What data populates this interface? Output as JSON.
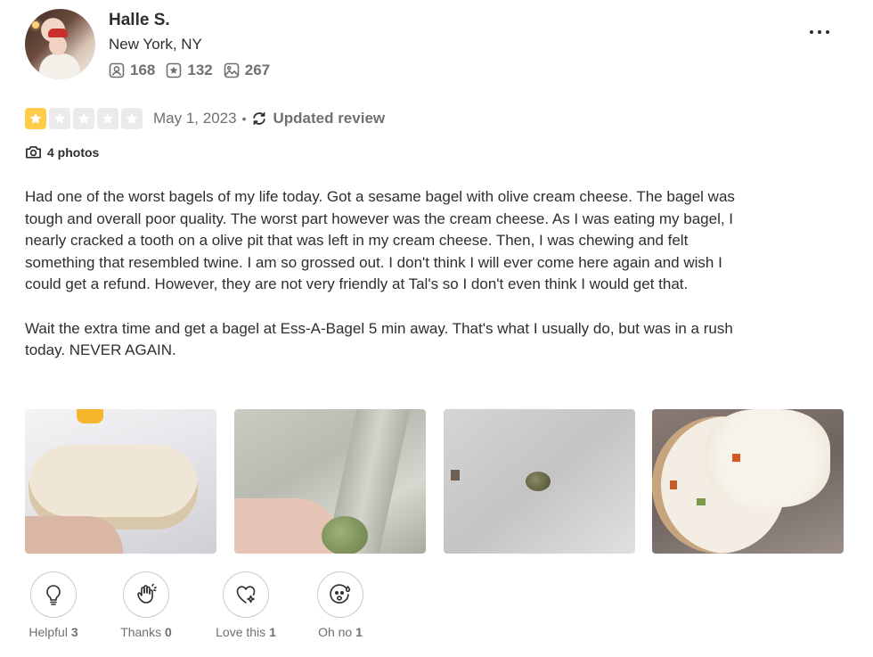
{
  "user": {
    "name": "Halle S.",
    "location": "New York, NY",
    "stats": {
      "friends": "168",
      "reviews": "132",
      "photos": "267"
    }
  },
  "review": {
    "rating": 1,
    "rating_max": 5,
    "date": "May 1, 2023",
    "separator": "•",
    "updated_label": "Updated review",
    "photos_label": "4 photos",
    "paragraphs": [
      "Had one of the worst bagels of my life today. Got a sesame bagel with olive cream cheese. The bagel was tough and overall poor quality. The worst part however was the cream cheese. As I was eating my bagel, I nearly cracked a tooth on a olive pit that was left in my cream cheese. Then, I was chewing and felt something that resembled twine. I am so grossed out. I don't think I will ever come here again and wish I could get a refund. However, they are not very friendly at Tal's so I don't even think I would get that.",
      "Wait the extra time and get a bagel at Ess-A-Bagel 5 min away. That's what I usually do, but was in a rush today. NEVER AGAIN."
    ]
  },
  "reactions": [
    {
      "label": "Helpful",
      "count": "3",
      "icon": "lightbulb-icon"
    },
    {
      "label": "Thanks",
      "count": "0",
      "icon": "clapping-hands-icon"
    },
    {
      "label": "Love this",
      "count": "1",
      "icon": "heart-sparkle-icon"
    },
    {
      "label": "Oh no",
      "count": "1",
      "icon": "sweat-face-icon"
    }
  ],
  "colors": {
    "star_on": "#ffcc4b",
    "star_off": "#ebebeb",
    "text": "#2d2e2f",
    "muted": "#6e7072"
  }
}
